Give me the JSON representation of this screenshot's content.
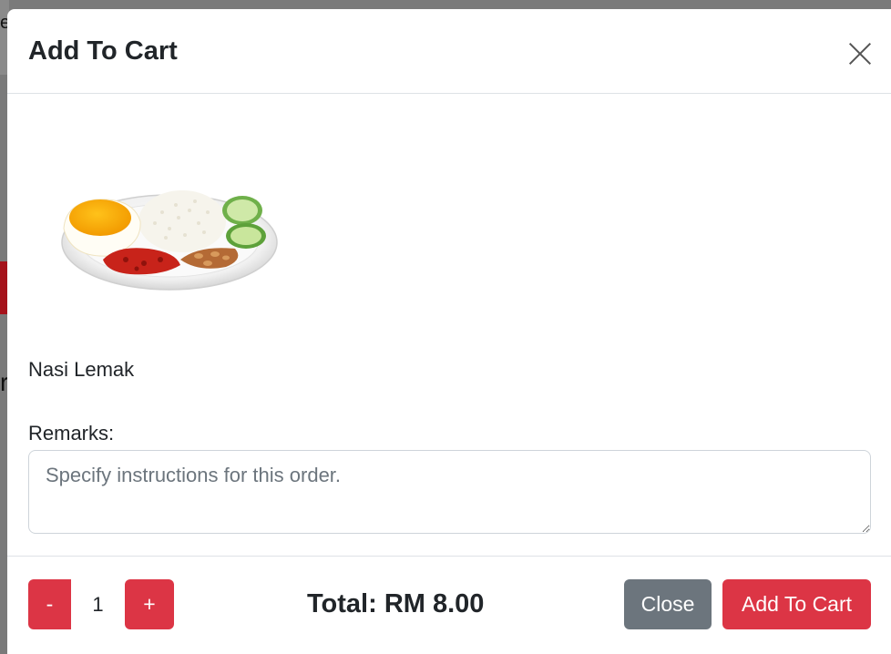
{
  "background": {
    "letter_top": "e",
    "letter_mid": "r"
  },
  "modal": {
    "title": "Add To Cart",
    "close_icon": "close-icon"
  },
  "item": {
    "name": "Nasi Lemak",
    "image_icon": "nasi-lemak-plate-image"
  },
  "remarks": {
    "label": "Remarks:",
    "placeholder": "Specify instructions for this order.",
    "value": ""
  },
  "quantity": {
    "minus_label": "-",
    "value": "1",
    "plus_label": "+"
  },
  "total": {
    "text": "Total: RM 8.00"
  },
  "buttons": {
    "close_label": "Close",
    "add_label": "Add To Cart"
  },
  "colors": {
    "primary_red": "#dc3545",
    "secondary_gray": "#6c757d",
    "backdrop": "#7a7a7a"
  }
}
